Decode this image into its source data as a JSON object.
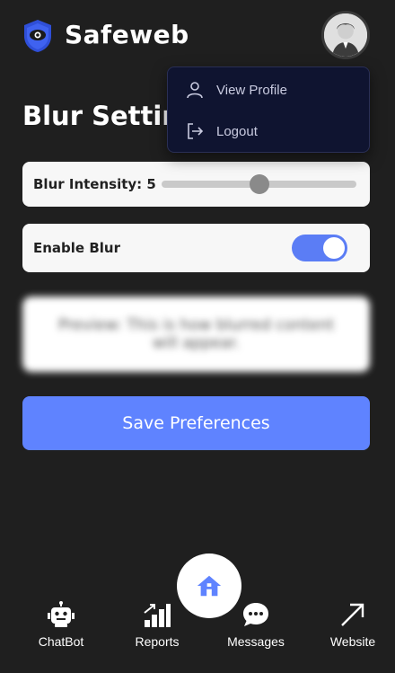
{
  "header": {
    "app_title": "Safeweb",
    "logo_icon": "eye-shield-icon",
    "avatar_icon": "user-avatar-icon"
  },
  "profile_menu": {
    "items": [
      {
        "label": "View Profile",
        "icon": "user-outline-icon"
      },
      {
        "label": "Logout",
        "icon": "logout-icon"
      }
    ]
  },
  "page": {
    "title": "Blur Settings"
  },
  "settings": {
    "intensity_label": "Blur Intensity: 5",
    "intensity_value": 5,
    "intensity_max": 10,
    "enable_blur_label": "Enable Blur",
    "enable_blur_on": true,
    "preview_text": "Preview: This is how blurred content will appear.",
    "save_label": "Save Preferences"
  },
  "bottom_nav": {
    "home_icon": "home-icon",
    "items": [
      {
        "label": "ChatBot",
        "icon": "robot-icon"
      },
      {
        "label": "Reports",
        "icon": "bar-chart-icon"
      },
      {
        "label": "Messages",
        "icon": "chat-bubble-icon"
      },
      {
        "label": "Website",
        "icon": "arrow-up-right-icon"
      }
    ]
  },
  "colors": {
    "background": "#1f1f1f",
    "accent": "#5f83ff",
    "toggle_on": "#5b7df5",
    "menu_bg": "#0f1430",
    "card_bg": "#f7f7f7"
  }
}
